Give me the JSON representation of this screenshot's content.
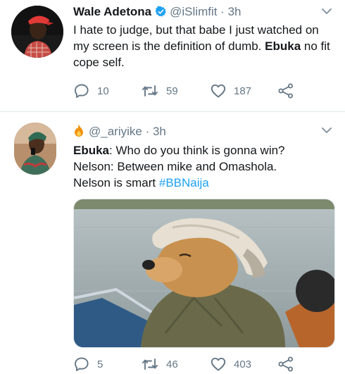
{
  "tweets": [
    {
      "display_name": "Wale Adetona",
      "handle": "@iSlimfit",
      "time": "3h",
      "text_part1": "I hate to judge, but that babe I just watched on my screen is the definition of dumb. ",
      "text_bold": "Ebuka",
      "text_part2": " no fit cope self.",
      "reply_count": "10",
      "retweet_count": "59",
      "like_count": "187"
    },
    {
      "handle": "@_ariyike",
      "time": "3h",
      "line1_bold": "Ebuka",
      "line1_rest": ": Who do you think is gonna win?",
      "line2": "Nelson: Between mike and Omashola.",
      "line3": "Nelson is smart",
      "hashtag": "#BBNaija",
      "reply_count": "5",
      "retweet_count": "46",
      "like_count": "403"
    }
  ],
  "icons": {
    "verified": "verified-badge-icon",
    "chevron": "chevron-down-icon",
    "reply": "reply-icon",
    "retweet": "retweet-icon",
    "like": "heart-icon",
    "share": "share-icon",
    "fire": "fire-emoji-icon"
  },
  "colors": {
    "accent": "#1da1f2",
    "secondary_text": "#657786",
    "divider": "#e1e8ed"
  }
}
